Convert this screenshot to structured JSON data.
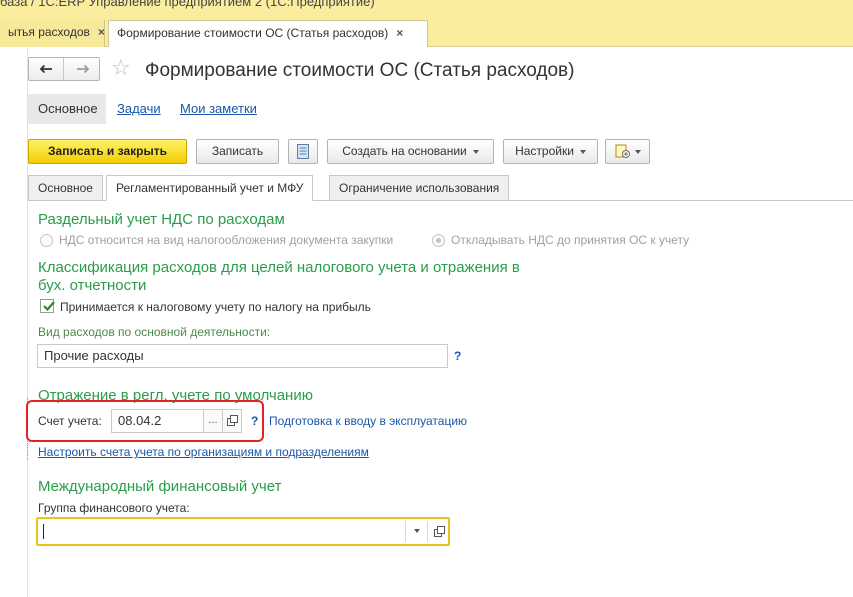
{
  "window": {
    "title": "база / 1С:ERP Управление предприятием 2  (1С:Предприятие)"
  },
  "window_tabs": [
    {
      "label": "ытья расходов",
      "close": "×"
    },
    {
      "label": "Формирование стоимости ОС (Статья расходов)",
      "close": "×"
    }
  ],
  "header": {
    "back_icon": "arrow-left-icon",
    "forward_icon": "arrow-right-icon",
    "star": "☆",
    "title": "Формирование стоимости ОС (Статья расходов)"
  },
  "sections": {
    "main": "Основное",
    "tasks": "Задачи",
    "notes": "Мои заметки"
  },
  "toolbar": {
    "save_close": "Записать и закрыть",
    "save": "Записать",
    "create_based_on": "Создать на основании",
    "settings": "Настройки"
  },
  "form_tabs": {
    "main": "Основное",
    "regl": "Регламентированный учет и МФУ",
    "limit": "Ограничение использования"
  },
  "vat": {
    "heading": "Раздельный учет НДС по расходам",
    "option1": "НДС относится на вид налогообложения документа закупки",
    "option2": "Откладывать НДС до принятия ОС к учету",
    "selected": "option2"
  },
  "tax": {
    "heading_line1": "Классификация расходов для целей налогового учета и отражения в",
    "heading_line2": "бух. отчетности",
    "profit_tax_label": "Принимается к налоговому учету по налогу на прибыль",
    "profit_tax_checked": true,
    "expense_type_label": "Вид расходов по основной деятельности:",
    "expense_type_value": "Прочие расходы",
    "help": "?"
  },
  "regl": {
    "heading": "Отражение в регл. учете по умолчанию",
    "account_label": "Счет учета:",
    "account_value": "08.04.2",
    "select_btn": "...",
    "help": "?",
    "account_name_link": "Подготовка к вводу в эксплуатацию",
    "setup_link": "Настроить счета учета по организациям и подразделениям"
  },
  "ifrs": {
    "heading": "Международный финансовый учет",
    "group_label": "Группа финансового учета:",
    "group_value": ""
  }
}
